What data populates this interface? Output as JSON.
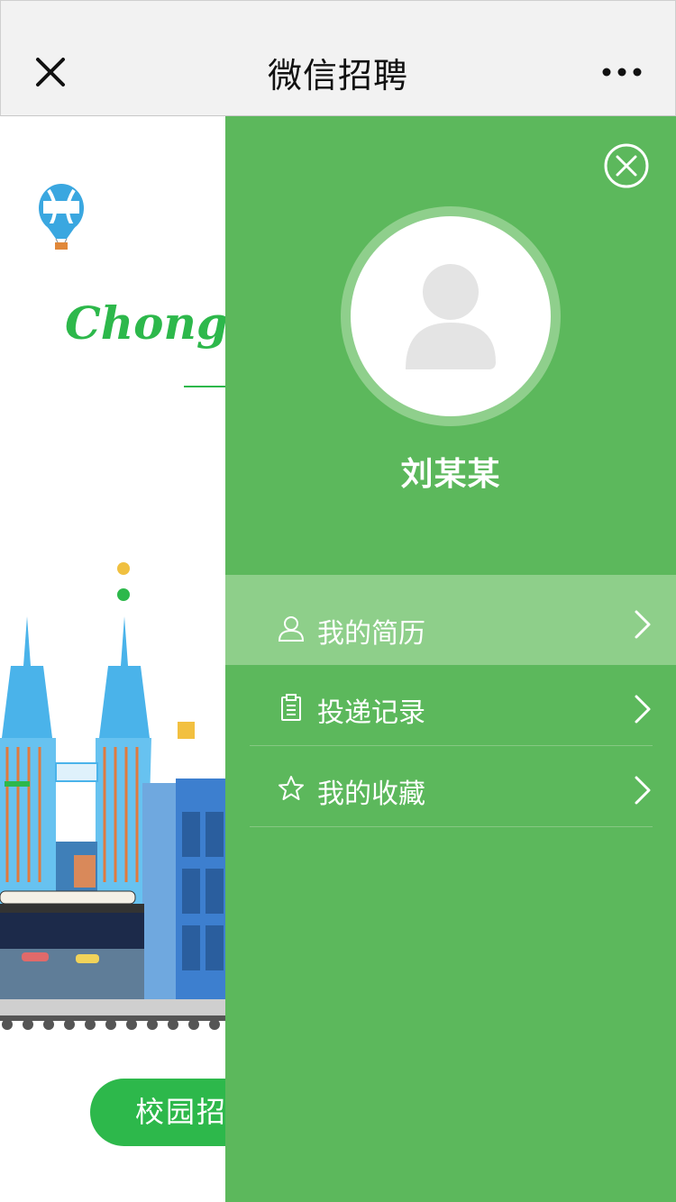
{
  "header": {
    "title": "微信招聘",
    "close_icon": "close-icon",
    "more_icon": "more-icon"
  },
  "background": {
    "brand_text": "Chongqi",
    "campus_button_label": "校园招"
  },
  "drawer": {
    "user_name": "刘某某",
    "close_icon": "circle-close-icon",
    "menu": [
      {
        "label": "我的简历",
        "icon": "user-icon",
        "active": true
      },
      {
        "label": "投递记录",
        "icon": "clipboard-icon",
        "active": false
      },
      {
        "label": "我的收藏",
        "icon": "star-icon",
        "active": false
      }
    ]
  },
  "colors": {
    "drawer_bg": "#5cb85c",
    "active_item_bg": "#8ecf8a",
    "brand_green": "#2db84b",
    "topbar_bg": "#f2f2f2"
  }
}
